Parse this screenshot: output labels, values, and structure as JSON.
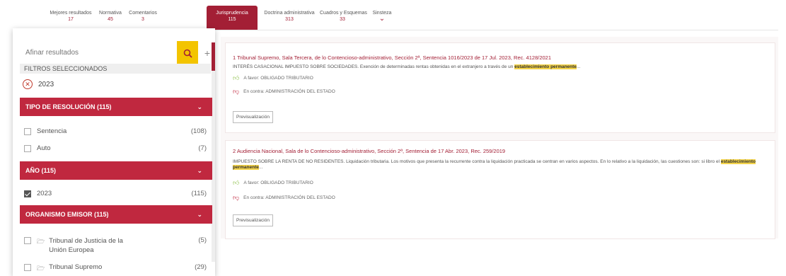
{
  "tabs": [
    {
      "label": "Mejores resultados",
      "count": "17"
    },
    {
      "label": "Normativa",
      "count": "45"
    },
    {
      "label": "Comentarios",
      "count": "3"
    },
    {
      "label": "Jurisprudencia",
      "count": "115"
    },
    {
      "label": "Doctrina administrativa",
      "count": "313"
    },
    {
      "label": "Cuadros y Esquemas",
      "count": "33"
    },
    {
      "label": "Sinsteza",
      "count": ""
    }
  ],
  "sidebar": {
    "search_placeholder": "Afinar resultados",
    "filters_title": "FILTROS SELECCIONADOS",
    "selected_filter": "2023",
    "sections": {
      "tipo": "TIPO DE RESOLUCIÓN (115)",
      "anio": "AÑO (115)",
      "organismo": "ORGANISMO EMISOR (115)"
    },
    "tipo_options": [
      {
        "label": "Sentencia",
        "count": "(108)"
      },
      {
        "label": "Auto",
        "count": "(7)"
      }
    ],
    "anio_options": [
      {
        "label": "2023",
        "count": "(115)"
      }
    ],
    "organismo_options": [
      {
        "label": "Tribunal de Justicia de la Unión Europea",
        "count": "(5)"
      },
      {
        "label": "Tribunal Supremo",
        "count": "(29)"
      }
    ]
  },
  "results": [
    {
      "title": "1 Tribunal Supremo, Sala Tercera, de lo Contencioso-administrativo, Sección 2ª, Sentencia 1016/2023 de 17 Jul. 2023, Rec. 4128/2021",
      "desc": "INTERÉS CASACIONAL IMPUESTO SOBRE SOCIEDADES. Exención de determinadas rentas obtenidas en el extranjero a través de un",
      "highlight": "establecimiento permanente",
      "desc_end": "...",
      "favor": "A favor: OBLIGADO TRIBUTARIO",
      "contra": "En contra: ADMINISTRACIÓN DEL ESTADO",
      "button": "Previsualización"
    },
    {
      "title": "2 Audiencia Nacional, Sala de lo Contencioso-administrativo, Sección 2ª, Sentencia de 17 Abr. 2023, Rec. 259/2019",
      "desc": "IMPUESTO SOBRE LA RENTA DE NO RESIDENTES. Liquidación tributaria. Los motivos que presenta la recurrente contra la liquidación practicada se centran en varios aspectos. En lo relativo a la liquidación, las cuestiones son: si libro el",
      "highlight": "establecimiento permanente",
      "desc_end": "...",
      "favor": "A favor: OBLIGADO TRIBUTARIO",
      "contra": "En contra: ADMINISTRACIÓN DEL ESTADO",
      "button": "Previsualización"
    }
  ],
  "colors": {
    "accent": "#c0283f",
    "search": "#f3c400"
  }
}
